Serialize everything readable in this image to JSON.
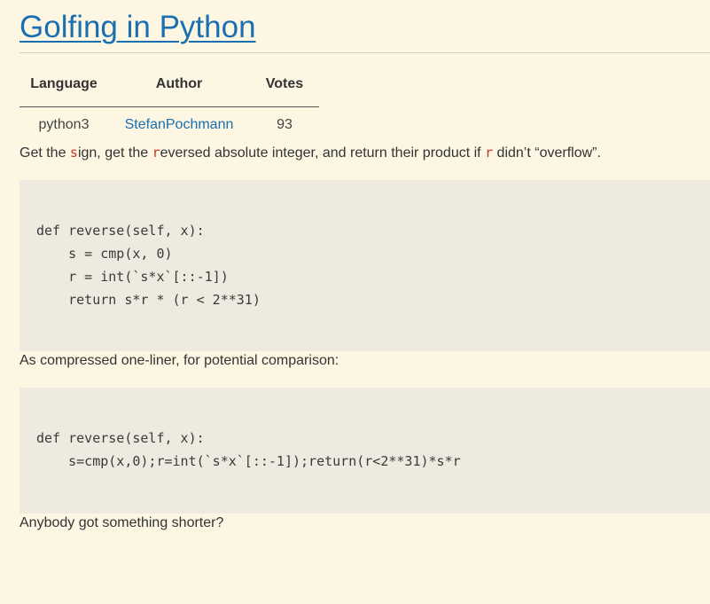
{
  "title": "Golfing in Python",
  "table": {
    "headers": [
      "Language",
      "Author",
      "Votes"
    ],
    "row": {
      "language": "python3",
      "author": "StefanPochmann",
      "votes": "93"
    }
  },
  "paragraph1": {
    "t1": "Get the ",
    "s1": "s",
    "t2": "ign, get the ",
    "r1": "r",
    "t3": "eversed absolute integer, and return their product if ",
    "r2": "r",
    "t4": " didn’t “overflow”."
  },
  "code1": [
    "def reverse(self, x):",
    "    s = cmp(x, 0)",
    "    r = int(`s*x`[::-1])",
    "    return s*r * (r < 2**31)"
  ],
  "paragraph2": "As compressed one-liner, for potential comparison:",
  "code2": [
    "def reverse(self, x):",
    "    s=cmp(x,0);r=int(`s*x`[::-1]);return(r<2**31)*s*r"
  ],
  "paragraph3": "Anybody got something shorter?"
}
